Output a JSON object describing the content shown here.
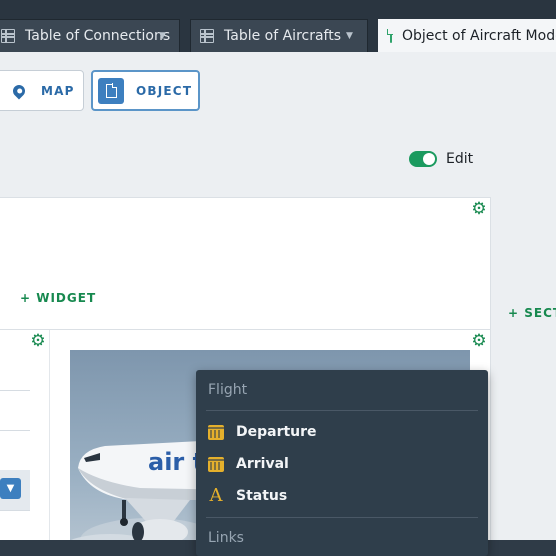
{
  "tabs": [
    {
      "label": "Table of Connections",
      "icon": "table-icon"
    },
    {
      "label": "Table of Aircrafts",
      "icon": "table-icon"
    },
    {
      "label": "Object of Aircraft Model",
      "icon": "document-icon",
      "active": true
    }
  ],
  "view_toggle": {
    "map_label": "MAP",
    "object_label": "OBJECT",
    "selected": "OBJECT"
  },
  "edit": {
    "label": "Edit",
    "enabled": true
  },
  "section": {
    "add_widget_label": "+ WIDGET",
    "add_section_label": "+ SECTI"
  },
  "menu": {
    "group1_header": "Flight",
    "items": [
      {
        "label": "Departure",
        "icon": "calendar-icon"
      },
      {
        "label": "Arrival",
        "icon": "calendar-icon"
      },
      {
        "label": "Status",
        "icon": "letter-a-icon"
      }
    ],
    "group2_header": "Links"
  },
  "colors": {
    "accent_green": "#17894f",
    "accent_blue": "#3d7fbf",
    "menu_bg": "#2f3e4b",
    "icon_gold": "#e5b02c"
  },
  "photo": {
    "tail_text": "air t"
  }
}
